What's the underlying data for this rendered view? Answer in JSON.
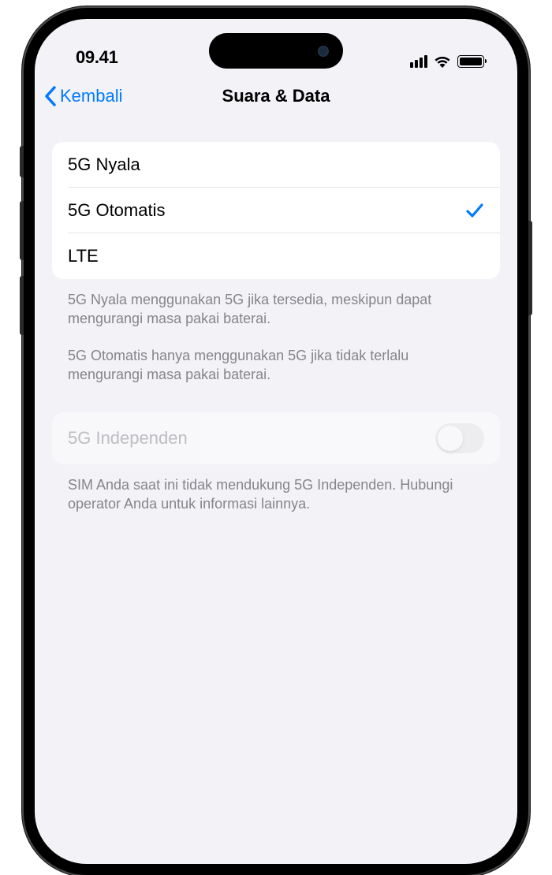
{
  "status_bar": {
    "time": "09.41"
  },
  "nav": {
    "back_label": "Kembali",
    "title": "Suara & Data"
  },
  "options": [
    {
      "label": "5G Nyala",
      "selected": false
    },
    {
      "label": "5G Otomatis",
      "selected": true
    },
    {
      "label": "LTE",
      "selected": false
    }
  ],
  "footer": {
    "text1": "5G Nyala menggunakan 5G jika tersedia, meskipun dapat mengurangi masa pakai baterai.",
    "text2": "5G Otomatis hanya menggunakan 5G jika tidak terlalu mengurangi masa pakai baterai."
  },
  "toggle": {
    "label": "5G Independen",
    "enabled": false,
    "footer": "SIM Anda saat ini tidak mendukung 5G Independen. Hubungi operator Anda untuk informasi lainnya."
  }
}
